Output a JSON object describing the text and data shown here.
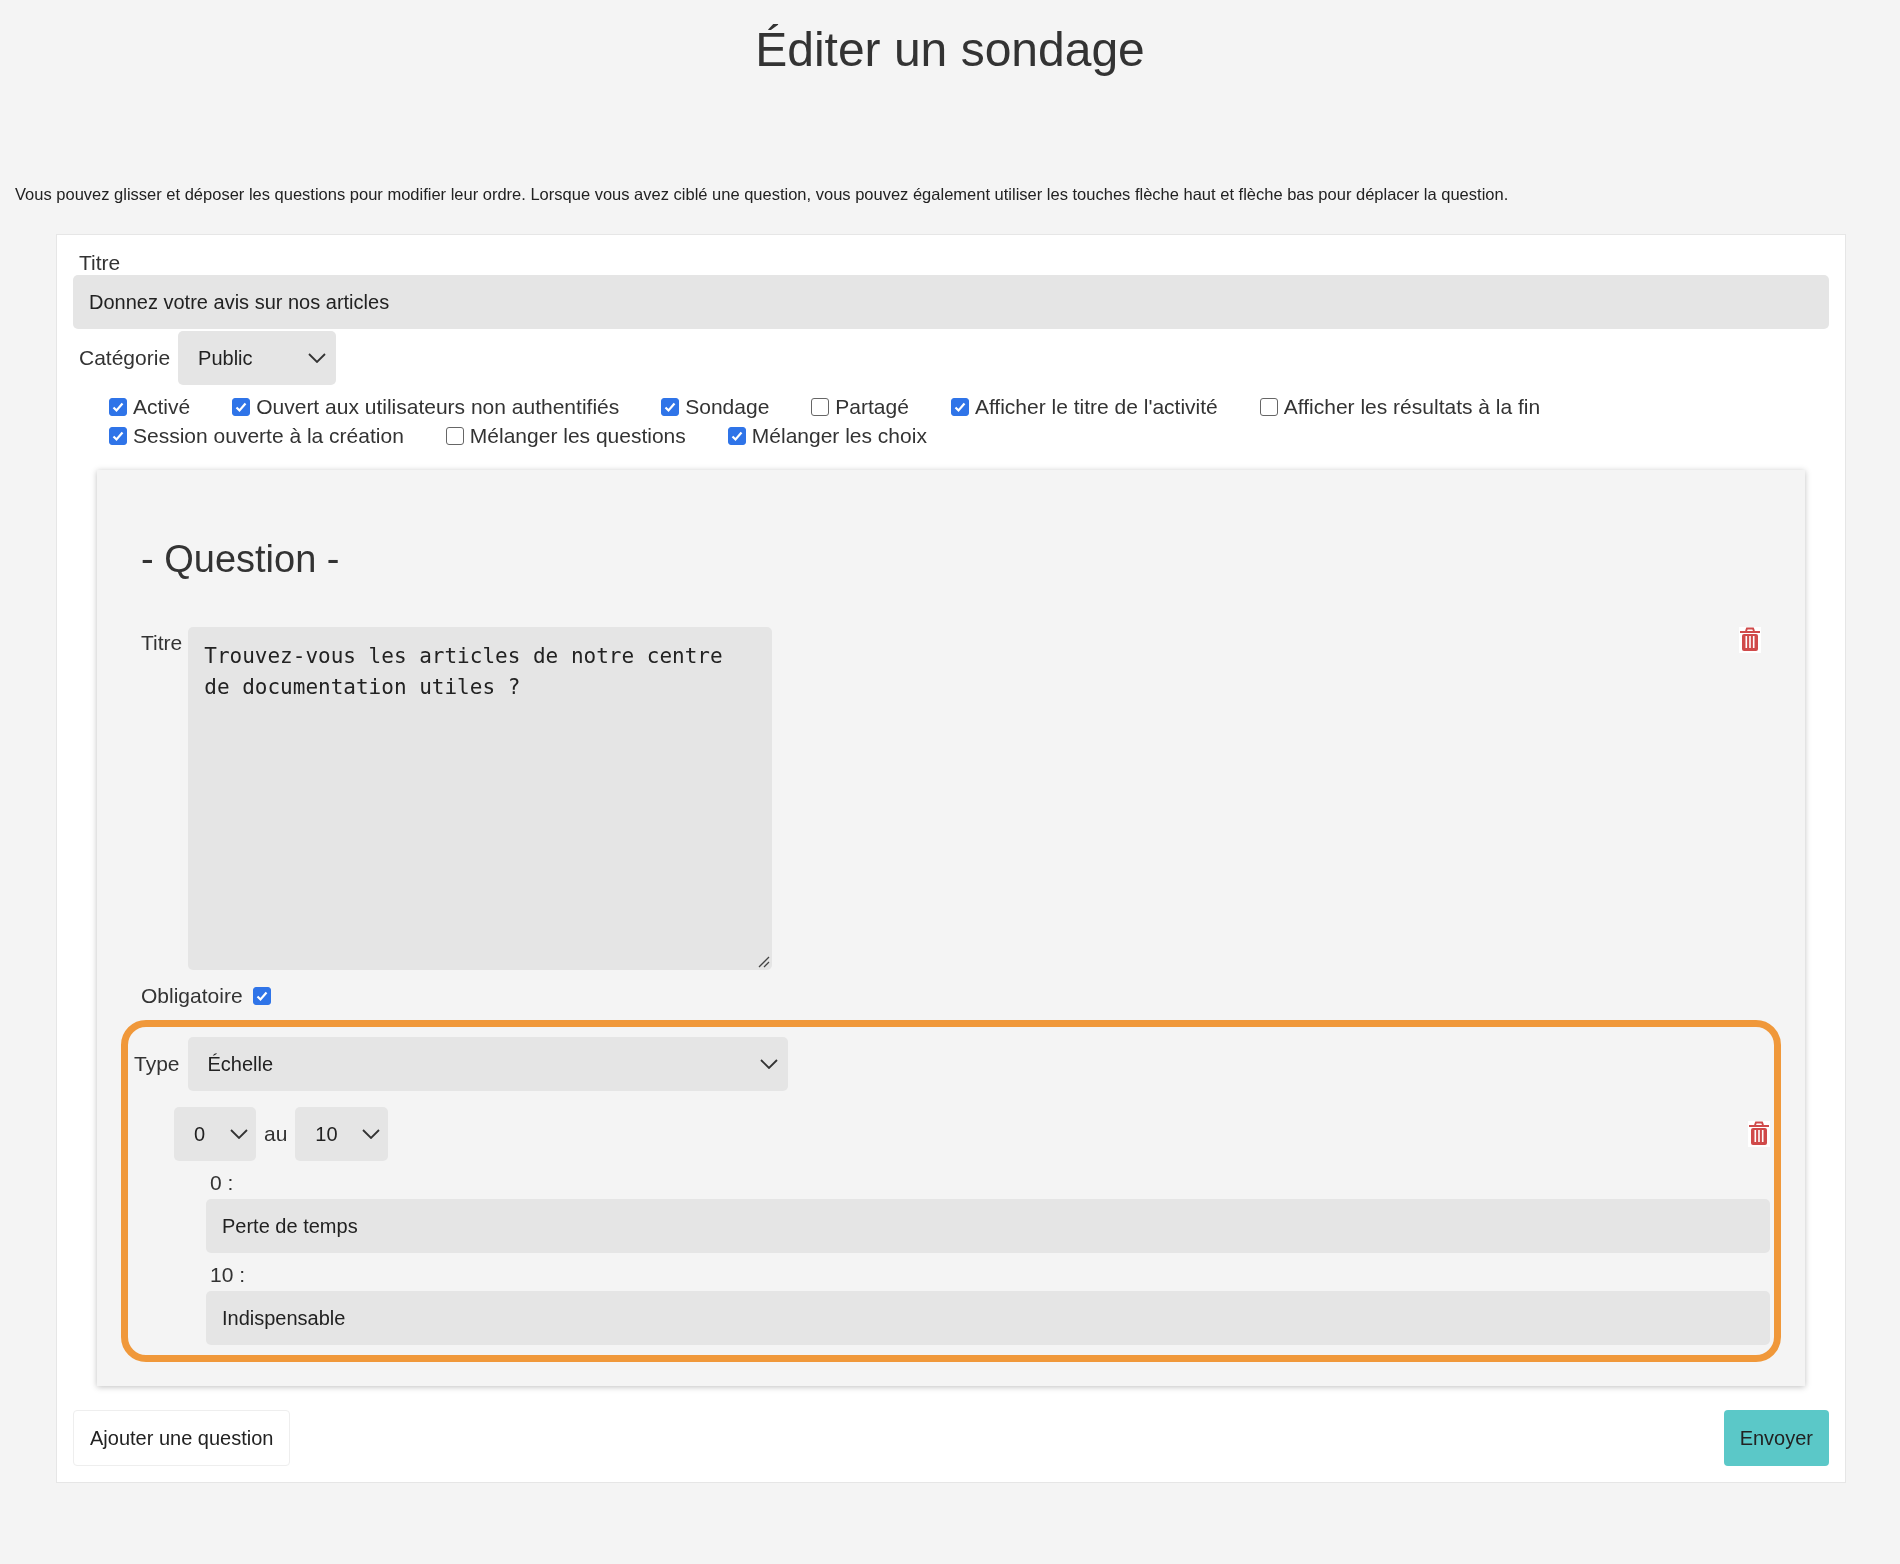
{
  "page_title": "Éditer un sondage",
  "instructions": "Vous pouvez glisser et déposer les questions pour modifier leur ordre. Lorsque vous avez ciblé une question, vous pouvez également utiliser les touches flèche haut et flèche bas pour déplacer la question.",
  "form": {
    "title_label": "Titre",
    "title_value": "Donnez votre avis sur nos articles",
    "category_label": "Catégorie",
    "category_value": "Public",
    "options": [
      {
        "label": "Activé",
        "checked": true
      },
      {
        "label": "Ouvert aux utilisateurs non authentifiés",
        "checked": true
      },
      {
        "label": "Sondage",
        "checked": true
      },
      {
        "label": "Partagé",
        "checked": false
      },
      {
        "label": "Afficher le titre de l'activité",
        "checked": true
      },
      {
        "label": "Afficher les résultats à la fin",
        "checked": false
      },
      {
        "label": "Session ouverte à la création",
        "checked": true
      },
      {
        "label": "Mélanger les questions",
        "checked": false
      },
      {
        "label": "Mélanger les choix",
        "checked": true
      }
    ]
  },
  "question": {
    "heading": "- Question -",
    "title_label": "Titre",
    "title_value": "Trouvez-vous les articles de notre centre\nde documentation utiles ?",
    "required_label": "Obligatoire",
    "required": true,
    "answer": {
      "highlighted": true,
      "type_label": "Type",
      "type_value": "Échelle",
      "from_value": "0",
      "separator": "au",
      "to_value": "10",
      "scale_labels": [
        {
          "label": "0 :",
          "value": "Perte de temps"
        },
        {
          "label": "10 :",
          "value": "Indispensable"
        }
      ]
    }
  },
  "buttons": {
    "add": "Ajouter une question",
    "submit": "Envoyer"
  }
}
